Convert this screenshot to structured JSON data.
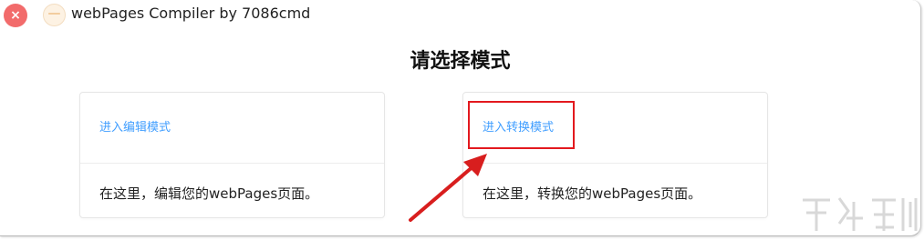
{
  "window": {
    "title": "webPages Compiler by 7086cmd",
    "close_glyph": "×",
    "minimize_glyph": "—",
    "close_color": "#f26b6b",
    "minimize_color": "#fdf2e3"
  },
  "main": {
    "title": "请选择模式",
    "cards": [
      {
        "link": "进入编辑模式",
        "description": "在这里，编辑您的webPages页面。"
      },
      {
        "link": "进入转换模式",
        "description": "在这里，转换您的webPages页面。"
      }
    ]
  },
  "annotation": {
    "highlight_color": "#e3191e",
    "arrow_icon": "red-arrow-icon"
  },
  "colors": {
    "link": "#409eff",
    "text": "#222222"
  }
}
